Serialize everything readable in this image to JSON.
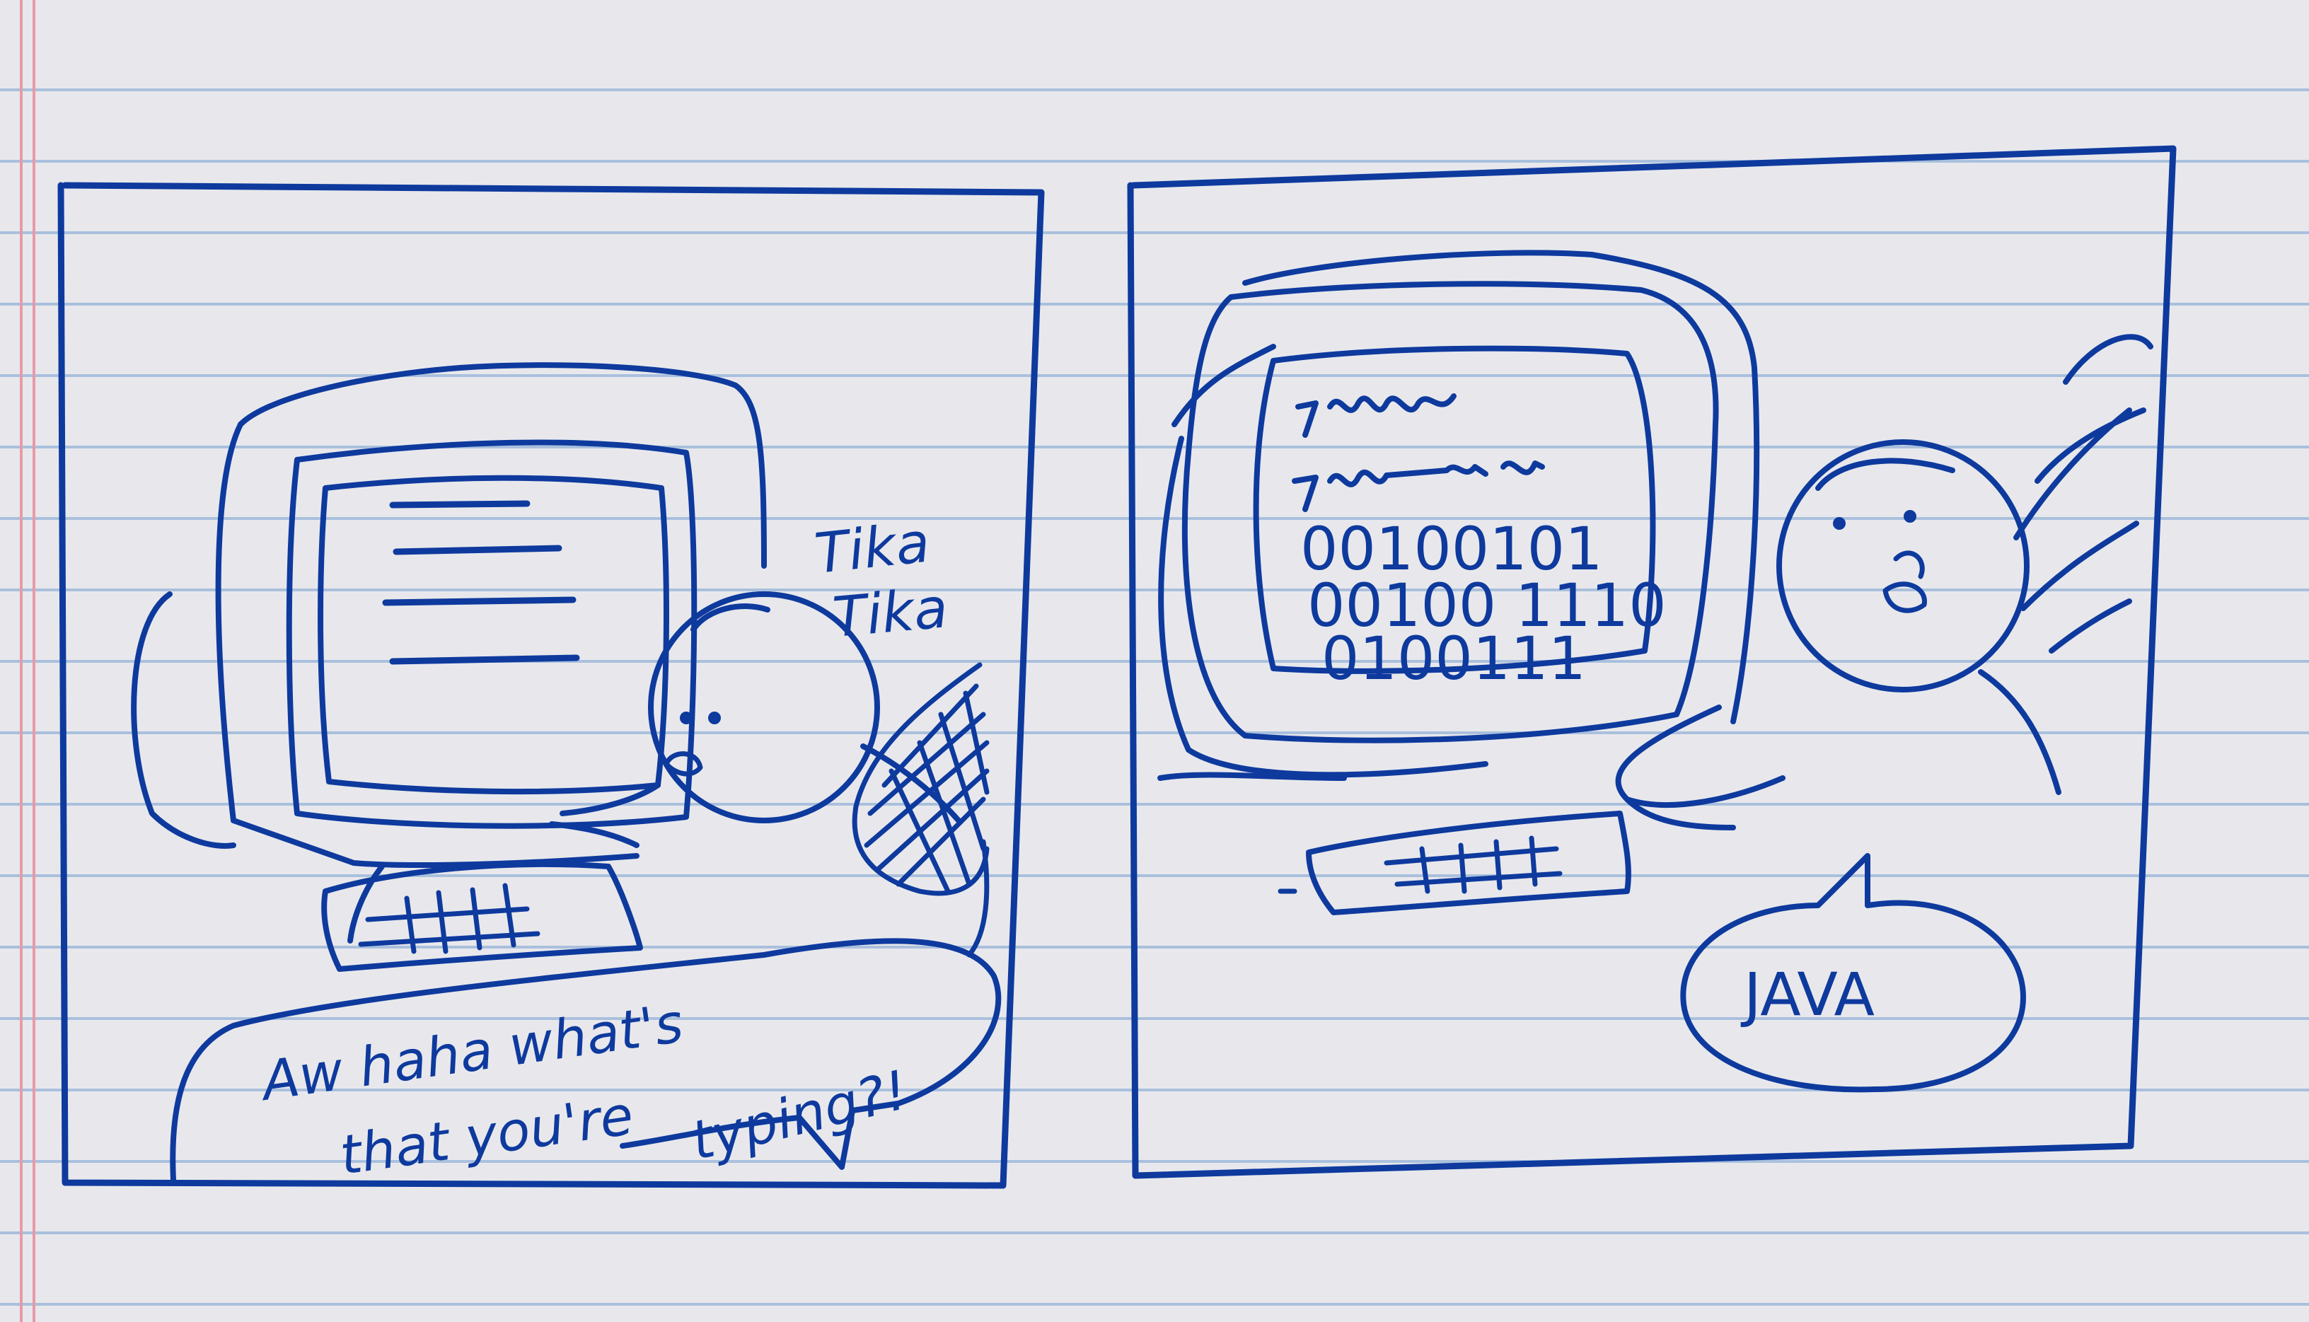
{
  "panel_left": {
    "sound_effect": [
      "Tika",
      "Tika"
    ],
    "speech_bubble": [
      "Aw haha what's",
      "that you're",
      "typing?!"
    ]
  },
  "panel_right": {
    "screen_code_lines": [
      "00100101",
      "00100 1110",
      "0100111"
    ],
    "speech_bubble": "JAVA"
  }
}
